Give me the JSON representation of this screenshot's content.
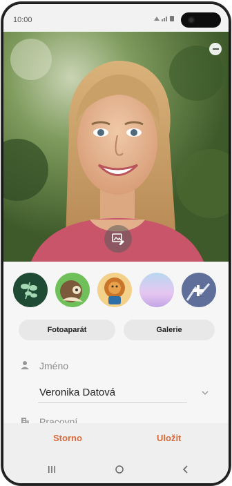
{
  "status_bar": {
    "time": "10:00"
  },
  "photo": {
    "edit_icon": "image-edit-icon",
    "close_icon": "minus-circle-icon"
  },
  "avatars": [
    {
      "name": "avatar-plant",
      "bg": "#1f4a33"
    },
    {
      "name": "avatar-face",
      "bg": "#6fbf5a"
    },
    {
      "name": "avatar-lion",
      "bg": "#f3a43a"
    },
    {
      "name": "avatar-gradient",
      "bg": "#c9b3e8"
    },
    {
      "name": "avatar-add",
      "bg": "#5f6f9a"
    }
  ],
  "buttons": {
    "camera": "Fotoaparát",
    "gallery": "Galerie"
  },
  "fields": {
    "name_label": "Jméno",
    "name_value": "Veronika Datová",
    "work_label": "Pracovní"
  },
  "actions": {
    "cancel": "Storno",
    "save": "Uložit"
  },
  "nav": {
    "recent": "recent-apps-icon",
    "home": "home-icon",
    "back": "back-icon"
  },
  "colors": {
    "accent": "#d86a3c",
    "sheet": "#f6f6f6"
  }
}
